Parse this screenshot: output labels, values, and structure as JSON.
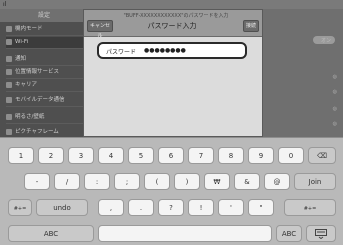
{
  "status": {
    "wifi": "ıl"
  },
  "sidebar": {
    "title": "設定",
    "items": [
      "機内モード",
      "Wi-Fi",
      "通知",
      "位置情報サービス",
      "キャリア",
      "モバイルデータ通信",
      "明るさ/壁紙",
      "ピクチャフレーム"
    ]
  },
  "detail": {
    "right_label": "オン"
  },
  "modal": {
    "subtitle": "\"BUFF-XXXXXXXXXXXX\"のパスワードを入力",
    "title": "パスワード入力",
    "cancel": "キャンセル",
    "join": "接続",
    "password_label": "パスワード",
    "password_value": "●●●●●●●●"
  },
  "keyboard": {
    "row1": [
      "1",
      "2",
      "3",
      "4",
      "5",
      "6",
      "7",
      "8",
      "9",
      "0"
    ],
    "backspace": "⌫",
    "row2": [
      "-",
      "/",
      ":",
      ";",
      "(",
      ")",
      "₩",
      "&",
      "@"
    ],
    "join": "Join",
    "row3_left": "#+=",
    "undo": "undo",
    "row3": [
      ",",
      ".",
      "?",
      "!",
      "'",
      "\""
    ],
    "row3_right": "#+=",
    "abc_left": "ABC",
    "abc_right": "ABC",
    "hide_keyboard_icon": "keyboard-hide-icon"
  }
}
